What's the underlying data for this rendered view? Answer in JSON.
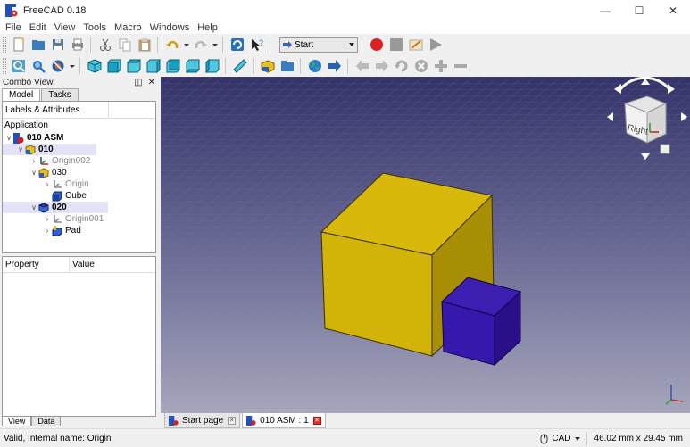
{
  "window": {
    "title": "FreeCAD 0.18"
  },
  "menu": [
    "File",
    "Edit",
    "View",
    "Tools",
    "Macro",
    "Windows",
    "Help"
  ],
  "toolbar": {
    "workbench_selected": "Start"
  },
  "combo_view": {
    "title": "Combo View",
    "tabs": [
      "Model",
      "Tasks"
    ],
    "active_tab": "Model",
    "tree_header": "Labels & Attributes",
    "tree_section": "Application",
    "tree": [
      {
        "label": "010 ASM",
        "bold": true,
        "highlight": false,
        "expanded": true
      },
      {
        "label": "010",
        "bold": true,
        "highlight": true,
        "expanded": true
      },
      {
        "label": "Origin002",
        "bold": false,
        "highlight": false,
        "dim": true
      },
      {
        "label": "030",
        "bold": false,
        "highlight": false,
        "expanded": true
      },
      {
        "label": "Origin",
        "bold": false,
        "highlight": false,
        "dim": true
      },
      {
        "label": "Cube",
        "bold": false,
        "highlight": false
      },
      {
        "label": "020",
        "bold": true,
        "highlight": true,
        "expanded": true
      },
      {
        "label": "Origin001",
        "bold": false,
        "highlight": false,
        "dim": true
      },
      {
        "label": "Pad",
        "bold": false,
        "highlight": false
      }
    ],
    "props_columns": [
      "Property",
      "Value"
    ],
    "bottom_tabs": [
      "View",
      "Data"
    ]
  },
  "viewport": {
    "background_top": "#3c3c6e",
    "background_bottom": "#a0a0b8",
    "nav_cube_label": "Right",
    "large_cube_color": "#d4b20a",
    "small_cube_color": "#3a1aa8"
  },
  "doc_tabs": [
    {
      "label": "Start page",
      "active": false
    },
    {
      "label": "010 ASM : 1",
      "active": true
    }
  ],
  "status": {
    "message": "Valid, Internal name: Origin",
    "nav_style": "CAD",
    "dimensions": "46.02 mm x 29.45 mm"
  }
}
